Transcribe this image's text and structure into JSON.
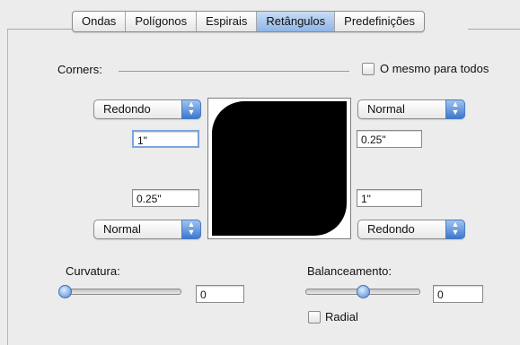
{
  "tabs": [
    {
      "label": "Ondas",
      "active": false
    },
    {
      "label": "Polígonos",
      "active": false
    },
    {
      "label": "Espirais",
      "active": false
    },
    {
      "label": "Retângulos",
      "active": true
    },
    {
      "label": "Predefinições",
      "active": false
    }
  ],
  "corners": {
    "label": "Corners:",
    "same_for_all_label": "O mesmo para todos",
    "same_for_all_checked": false,
    "top_left": {
      "style": "Redondo",
      "size": "1\""
    },
    "top_right": {
      "style": "Normal",
      "size": "0.25\""
    },
    "bottom_left": {
      "style": "Normal",
      "size": "0.25\""
    },
    "bottom_right": {
      "style": "Redondo",
      "size": "1\""
    }
  },
  "curvature": {
    "label": "Curvatura:",
    "value": "0",
    "slider_fraction": 0.0
  },
  "balance": {
    "label": "Balanceamento:",
    "value": "0",
    "slider_fraction": 0.5
  },
  "radial": {
    "label": "Radial",
    "checked": false
  },
  "colors": {
    "accent": "#3c78d0",
    "shape_fill": "#000000",
    "background": "#ececec"
  }
}
